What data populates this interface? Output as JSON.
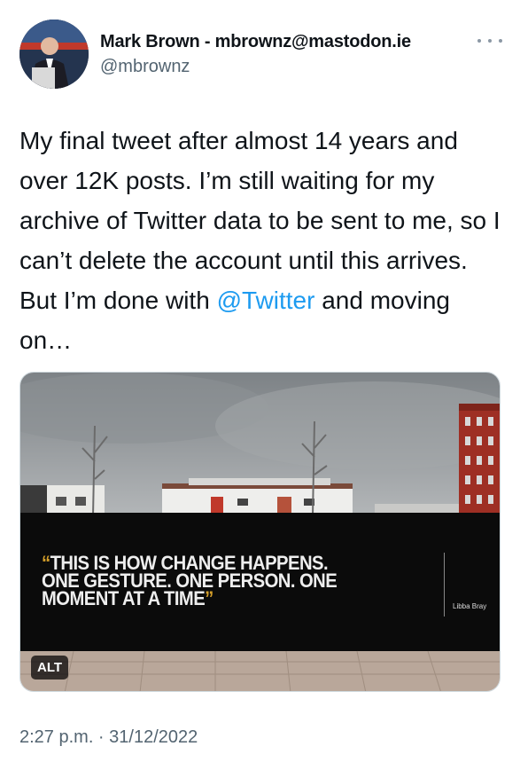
{
  "author": {
    "display_name": "Mark Brown - mbrownz@mastodon.ie",
    "handle": "@mbrownz",
    "avatar_icon": "profile-photo"
  },
  "tweet": {
    "text_before": "My final tweet after almost 14 years and over 12K posts. I’m still waiting for my archive of Twitter data to be sent to me, so I can’t delete the account until this arrives. But I’m done with ",
    "mention": "@Twitter",
    "text_after": " and moving on…"
  },
  "media": {
    "alt_label": "ALT",
    "quote_open": "“",
    "quote_line1": "THIS IS HOW CHANGE HAPPENS.",
    "quote_line2": "ONE GESTURE. ONE PERSON. ONE",
    "quote_line3": "MOMENT AT A TIME",
    "quote_close": "”",
    "attribution": "Libba Bray"
  },
  "meta": {
    "timestamp": "2:27 p.m. · 31/12/2022"
  },
  "colors": {
    "link": "#1d9bf0",
    "secondary_text": "#536471",
    "quote_mark": "#d6a02a"
  }
}
